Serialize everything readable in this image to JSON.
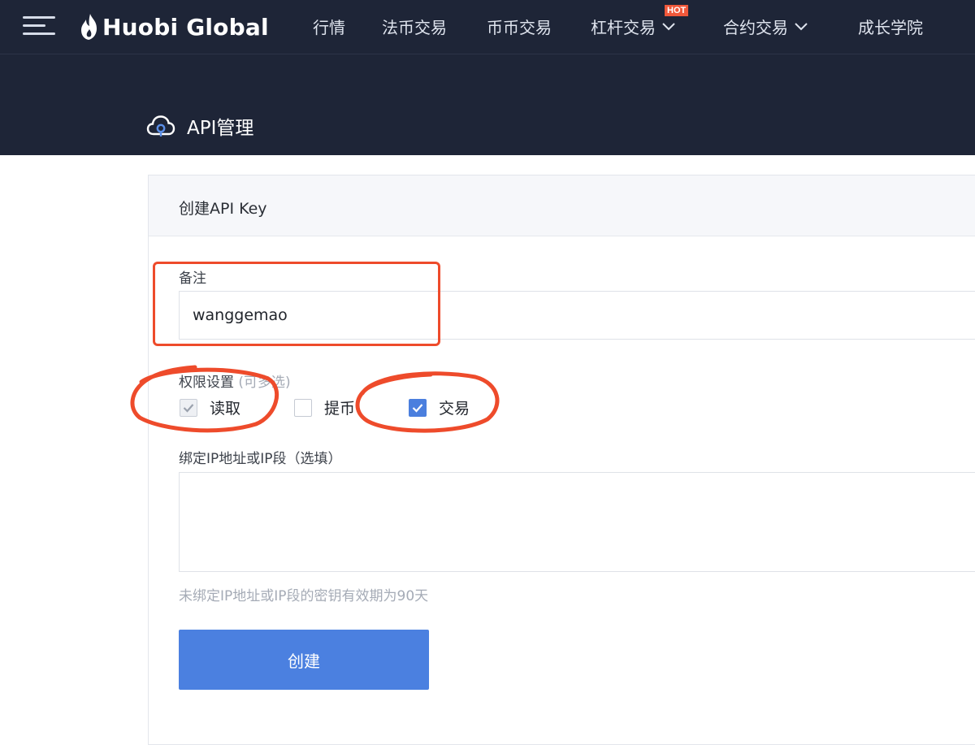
{
  "nav": {
    "brand": "Huobi Global",
    "items": [
      {
        "label": "行情"
      },
      {
        "label": "法币交易"
      },
      {
        "label": "币币交易"
      },
      {
        "label": "杠杆交易"
      },
      {
        "label": "合约交易"
      },
      {
        "label": "成长学院"
      }
    ],
    "hot_badge": "HOT"
  },
  "page": {
    "title": "API管理"
  },
  "card": {
    "title": "创建API Key",
    "remark": {
      "label": "备注",
      "value": "wanggemao"
    },
    "permissions": {
      "label": "权限设置",
      "label_hint": "(可多选)",
      "options": [
        {
          "label": "读取",
          "checked": true,
          "disabled": true
        },
        {
          "label": "提币",
          "checked": false
        },
        {
          "label": "交易",
          "checked": true
        }
      ]
    },
    "ip_binding": {
      "label": "绑定IP地址或IP段（选填）",
      "value": "",
      "hint": "未绑定IP地址或IP段的密钥有效期为90天"
    },
    "submit_label": "创建"
  },
  "colors": {
    "nav_bg": "#1e2537",
    "primary": "#4b80e0",
    "annotation_red": "#ee4b2b",
    "hot_badge": "#f0583b"
  }
}
